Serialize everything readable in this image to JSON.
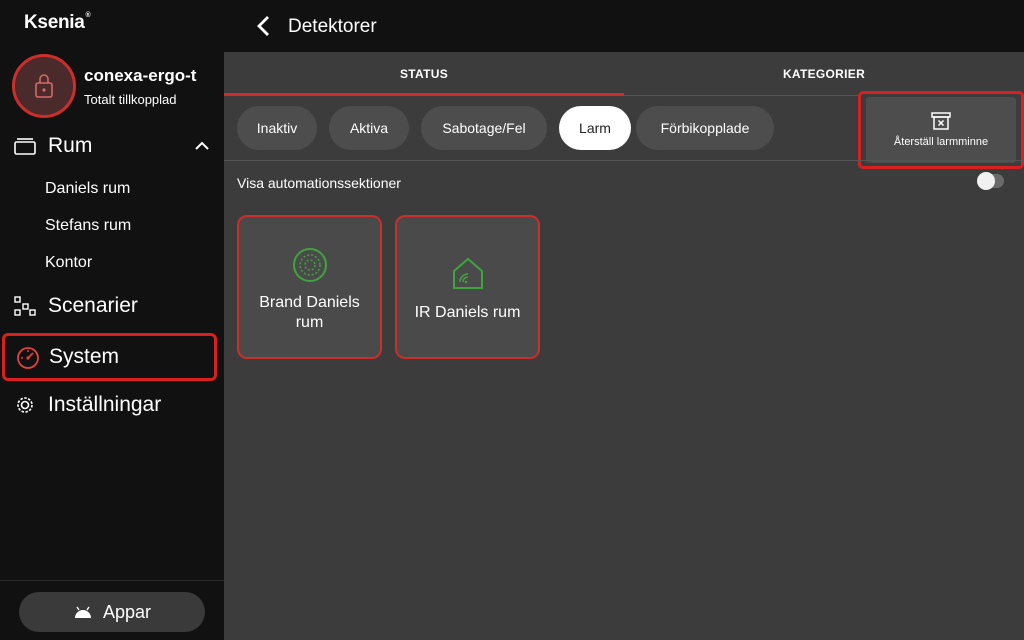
{
  "brand": {
    "logo_text": "Ksenia"
  },
  "panel": {
    "name": "conexa-ergo-t",
    "status": "Totalt tillkopplad"
  },
  "sidebar": {
    "rum": {
      "label": "Rum",
      "items": [
        "Daniels rum",
        "Stefans rum",
        "Kontor"
      ]
    },
    "scenarier": {
      "label": "Scenarier"
    },
    "system": {
      "label": "System"
    },
    "installningar": {
      "label": "Inställningar"
    },
    "apps_label": "Appar"
  },
  "header": {
    "title": "Detektorer"
  },
  "tabs": [
    {
      "label": "STATUS",
      "active": true
    },
    {
      "label": "KATEGORIER",
      "active": false
    }
  ],
  "filters": [
    {
      "label": "Inaktiv",
      "active": false
    },
    {
      "label": "Aktiva",
      "active": false
    },
    {
      "label": "Sabotage/Fel",
      "active": false
    },
    {
      "label": "Larm",
      "active": true
    },
    {
      "label": "Förbikopplade",
      "active": false
    }
  ],
  "reset_button": {
    "label": "Återställ larmminne"
  },
  "automation_toggle": {
    "label": "Visa automationssektioner",
    "on": false
  },
  "detectors": [
    {
      "label": "Brand Daniels rum",
      "icon": "smoke-detector-icon"
    },
    {
      "label": "IR Daniels rum",
      "icon": "home-wifi-icon"
    }
  ],
  "colors": {
    "accent": "#cc2e2a",
    "icon_green": "#3fa33f",
    "sidebar_bg": "#111111",
    "content_bg": "#3c3c3c"
  }
}
